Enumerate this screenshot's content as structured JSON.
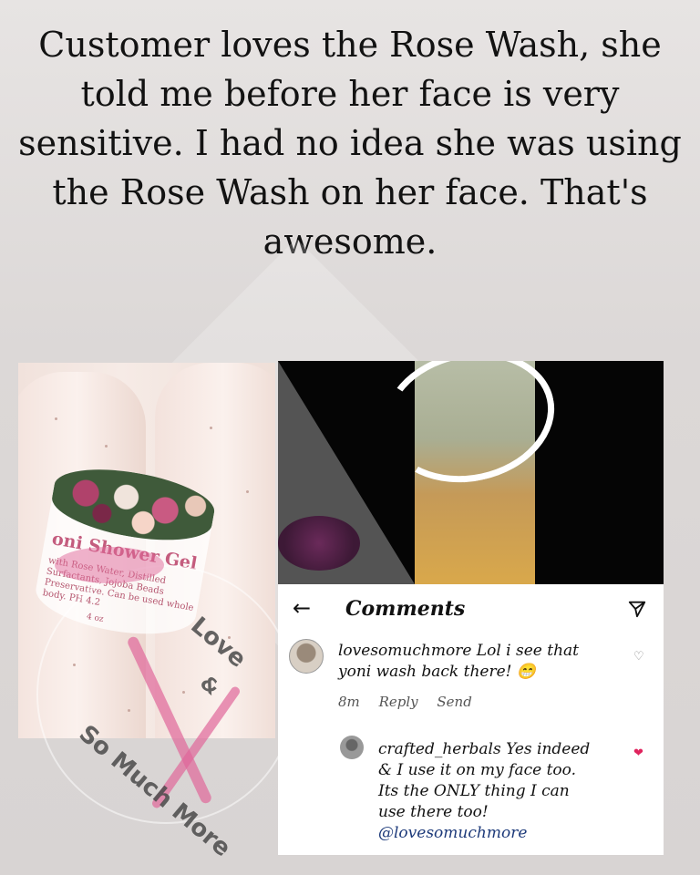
{
  "caption": "Customer loves the Rose Wash, she told me before her face is very sensitive. I had no idea she was using the Rose Wash on her face. That's awesome.",
  "product_label": {
    "title": "oni Shower Gel",
    "ingredients": "with Rose Water, Distilled Surfactants, Jojoba Beads Preservative. Can be used whole body. PH 4.2",
    "size": "4 oz"
  },
  "watermark": {
    "line1": "Love",
    "line2": "&",
    "line3": "So Much More"
  },
  "comments_panel": {
    "back_icon": "back-arrow-icon",
    "title": "Comments",
    "send_icon": "send-icon",
    "comments": [
      {
        "username": "lovesomuchmore",
        "text": "Lol i see that yoni wash back there! 😁",
        "time": "8m",
        "reply_label": "Reply",
        "send_label": "Send",
        "liked": false
      },
      {
        "username": "crafted_herbals",
        "text": "Yes indeed & I use it on my face too. Its the ONLY thing I can use there too!",
        "mention": "@lovesomuchmore",
        "liked": true
      }
    ]
  },
  "colors": {
    "like_active": "#e0245e",
    "accent_pink": "#e0679a"
  }
}
